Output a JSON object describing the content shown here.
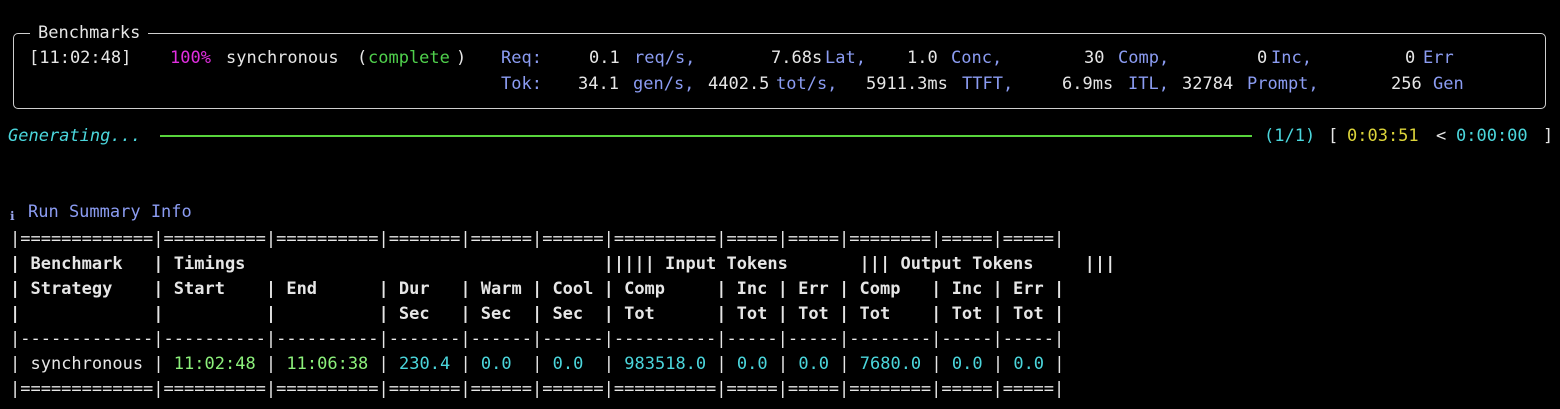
{
  "panel": {
    "title": "Benchmarks",
    "row1": {
      "timestamp": "[11:02:48]",
      "percent": "100%",
      "strategy": "synchronous",
      "status_open": "(",
      "status": "complete",
      "status_close": ")",
      "req_label": "Req:",
      "req_rate": "0.1",
      "req_rate_unit": "req/s,",
      "lat": "7.68s",
      "lat_unit": "Lat,",
      "conc": "1.0",
      "conc_unit": "Conc,",
      "comp": "30",
      "comp_unit": "Comp,",
      "inc": "0",
      "inc_unit": "Inc,",
      "err": "0",
      "err_unit": "Err"
    },
    "row2": {
      "tok_label": "Tok:",
      "gen_rate": "34.1",
      "gen_rate_unit": "gen/s,",
      "tot_rate": "4402.5",
      "tot_rate_unit": "tot/s,",
      "ttft": "5911.3ms",
      "ttft_unit": "TTFT,",
      "itl": "6.9ms",
      "itl_unit": "ITL,",
      "prompt": "32784",
      "prompt_unit": "Prompt,",
      "gen": "256",
      "gen_unit": "Gen"
    }
  },
  "progress": {
    "label": "Generating...",
    "count": "(1/1)",
    "bracket_open": "[",
    "elapsed": "0:03:51",
    "lt": "<",
    "remaining": "0:00:00",
    "bracket_close": "]"
  },
  "summary": {
    "icon": "info-icon",
    "title": "Run Summary Info",
    "rule": "|=============|==========|==========|=======|======|======|==========|=====|=====|========|=====|=====|",
    "header1": {
      "c1": "| Benchmark   ",
      "c2": "| Timings                                   |||||",
      "c3": " Input Tokens       |||",
      "c4": " Output Tokens     |||"
    },
    "header2": "| Strategy    | Start    | End      | Dur   | Warm | Cool | Comp     | Inc | Err | Comp   | Inc | Err |",
    "header3": "|             |          |          | Sec   | Sec  | Sec  | Tot      | Tot | Tot | Tot    | Tot | Tot |",
    "divider": "|-------------|----------|----------|-------|------|------|----------|-----|-----|--------|-----|-----|",
    "data_row": {
      "strategy": "synchronous",
      "start": "11:02:48",
      "end": "11:06:38",
      "dur": "230.4",
      "warm": "0.0",
      "cool": "0.0",
      "in_comp": "983518.0",
      "in_inc": "0.0",
      "in_err": "0.0",
      "out_comp": "7680.0",
      "out_inc": "0.0",
      "out_err": "0.0"
    }
  },
  "colors": {
    "background": "#000000",
    "magenta": "#e12ee0",
    "green": "#4fd04c",
    "blue": "#8b9cf2",
    "cyan": "#4bd6dc",
    "yellow": "#dcd43a"
  }
}
